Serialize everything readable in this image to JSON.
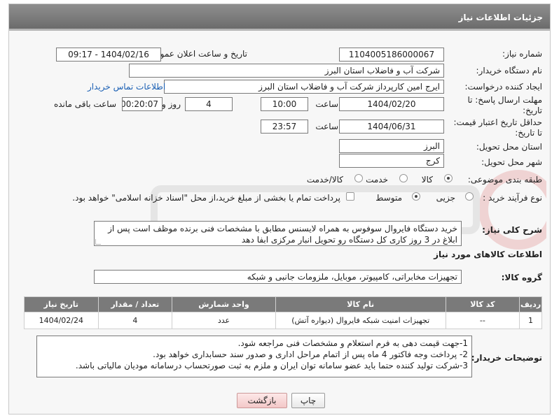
{
  "header": {
    "title": "جزئیات اطلاعات نیاز"
  },
  "fields": {
    "need_number_label": "شماره نیاز:",
    "need_number": "1104005186000067",
    "announce_label": "تاریخ و ساعت اعلان عمومی:",
    "announce_value": "1404/02/16 - 09:17",
    "buyer_org_label": "نام دستگاه خریدار:",
    "buyer_org": "شرکت آب و فاضلاب استان البرز",
    "creator_label": "ایجاد کننده درخواست:",
    "creator": "ایرج امین کارپرداز شرکت آب و فاضلاب استان البرز",
    "contact_link": "اطلاعات تماس خریدار",
    "deadline_label_1": "مهلت ارسال پاسخ: تا",
    "deadline_label_2": "تاریخ:",
    "deadline_date": "1404/02/20",
    "hour_label": "ساعت",
    "deadline_time": "10:00",
    "days_value": "4",
    "days_label": "روز و",
    "remaining_time": "00:20:07",
    "remaining_label": "ساعت باقی مانده",
    "price_validity_label_1": "حداقل تاریخ اعتبار قیمت:",
    "price_validity_label_2": "تا تاریخ:",
    "price_validity_date": "1404/06/31",
    "price_validity_time": "23:57",
    "province_label": "استان محل تحویل:",
    "province": "البرز",
    "city_label": "شهر محل تحویل:",
    "city": "کرج",
    "category_label": "طبقه بندی موضوعی:",
    "category_options": [
      "کالا",
      "خدمت",
      "کالا/خدمت"
    ],
    "category_selected": "کالا",
    "process_label": "نوع فرآیند خرید :",
    "process_options": [
      "جزیی",
      "متوسط"
    ],
    "process_selected": "متوسط",
    "payment_note": "پرداخت تمام یا بخشی از مبلغ خرید،از محل \"اسناد خزانه اسلامی\" خواهد بود."
  },
  "description": {
    "label": "شرح کلی نیاز:",
    "text": "خرید دستگاه فایروال سوفوس به همراه لایسنس مطابق با مشخصات فنی برنده موظف است پس از ابلاغ در 3 روز کاری کل دستگاه رو تحویل انبار مرکزی ابفا دهد"
  },
  "goods_info": {
    "title": "اطلاعات کالاهای مورد نیاز",
    "group_label": "گروه کالا:",
    "group_value": "تجهیزات مخابراتی، کامپیوتر، موبایل، ملزومات جانبی و شبکه"
  },
  "table": {
    "headers": [
      "ردیف",
      "کد کالا",
      "نام کالا",
      "واحد شمارش",
      "تعداد / مقدار",
      "تاریخ نیاز"
    ],
    "rows": [
      {
        "row": "1",
        "code": "--",
        "name": "تجهیزات امنیت شبکه فایروال (دیواره آتش)",
        "unit": "عدد",
        "qty": "4",
        "date": "1404/02/24"
      }
    ]
  },
  "buyer_notes": {
    "label": "توضیحات خریدار:",
    "lines": [
      "1-جهت قیمت دهی به فرم استعلام و مشخصات فنی مراجعه شود.",
      "2- پرداخت وجه فاکتور 4 ماه پس از اتمام مراحل اداری و صدور سند حسابداری خواهد بود.",
      "3-شرکت تولید کننده حتما باید عضو سامانه توان ایران و ملزم به ثبت صورتحساب درسامانه مودیان مالیاتی باشد."
    ]
  },
  "buttons": {
    "print": "چاپ",
    "back": "بازگشت"
  },
  "colors": {
    "header": "#7a7a7a",
    "link": "#1a5fb4",
    "back_button": "#f3c8c8"
  }
}
